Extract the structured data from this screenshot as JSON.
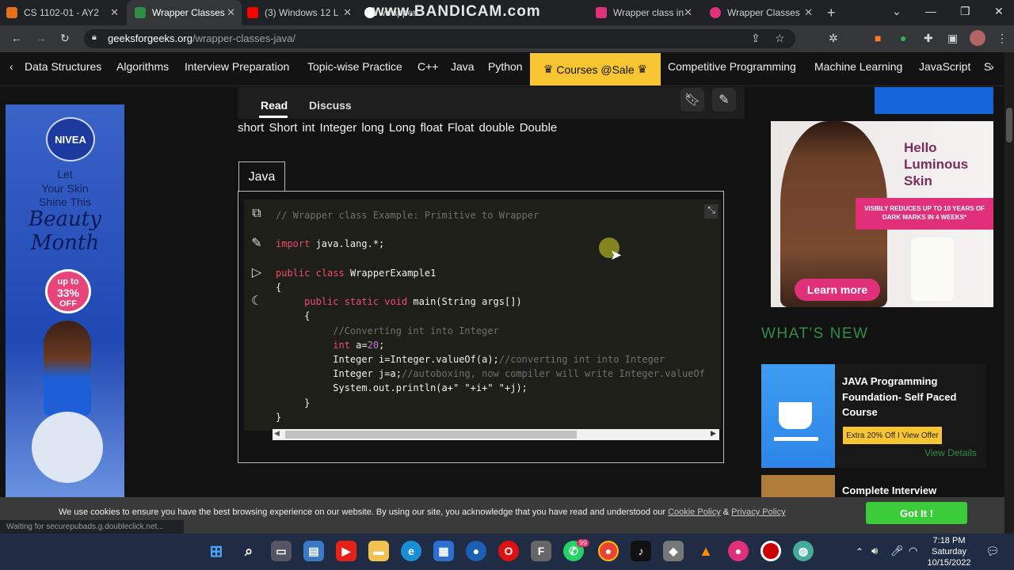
{
  "browser": {
    "tabs": [
      {
        "title": "CS 1102-01 - AY2",
        "favicon": "moodle-icon",
        "color": "#e7711b"
      },
      {
        "title": "Wrapper Classes",
        "favicon": "gfg-icon",
        "color": "#2f8d46"
      },
      {
        "title": "(3) Windows 12 L",
        "favicon": "youtube-icon",
        "color": "#ff0000"
      },
      {
        "title": "wrapper",
        "favicon": "google-icon",
        "color": "#ffffff"
      },
      {
        "title": "Wrapper class in",
        "favicon": "other-icon",
        "color": "#e0307a"
      },
      {
        "title": "Wrapper Classes",
        "favicon": "testbook-icon",
        "color": "#e0307a"
      }
    ],
    "new_tab": "+",
    "watermark": "www.BANDICAM.com",
    "url_domain": "geeksforgeeks.org",
    "url_path": "/wrapper-classes-java/"
  },
  "nav": {
    "items": [
      "Data Structures",
      "Algorithms",
      "Interview Preparation",
      "Topic-wise Practice",
      "C++",
      "Java",
      "Python"
    ],
    "courses": "Courses @Sale",
    "items_after": [
      "Competitive Programming",
      "Machine Learning",
      "JavaScript",
      "S"
    ]
  },
  "left_ad": {
    "brand": "NIVEA",
    "line1": "Let",
    "line2": "Your Skin",
    "line3": "Shine This",
    "headline": "Beauty Month",
    "badge_top": "up to",
    "badge_value": "33%",
    "badge_bottom": "OFF"
  },
  "article": {
    "tabs": {
      "read": "Read",
      "discuss": "Discuss"
    },
    "types_line": "short  Short  int Integer  long  Long  float  Float  double  Double",
    "language_tab": "Java",
    "code": {
      "line1": "// Wrapper class Example: Primitive to Wrapper",
      "import_kw": "import",
      "import_rest": " java.lang.*;",
      "public_kw": "public",
      "class_kw": "class",
      "class_name": " WrapperExample1",
      "open_brace": "{",
      "public_static_void": "public static void",
      "main_sig": " main(String args[])",
      "inner_open": "{",
      "comment2": "//Converting int into Integer",
      "int_kw": "int",
      "a_assign": " a=",
      "twenty": "20",
      "semi": ";",
      "integer_i": "Integer i=Integer.valueOf(a);",
      "comment3": "//converting int into Integer",
      "integer_j": "Integer j=a;",
      "comment4": "//autoboxing, now compiler will write Integer.valueOf",
      "println": "System.out.println(a+\" \"+i+\" \"+j);",
      "inner_close": "}",
      "close_brace": "}"
    }
  },
  "right": {
    "ad_headline": "Hello Luminous Skin",
    "ad_band": "VISIBLY REDUCES UP TO 10 YEARS OF DARK MARKS IN 4 WEEKS*",
    "ad_cta": "Learn more",
    "whats_new": "WHAT'S NEW",
    "card1_title": "JAVA Programming Foundation- Self Paced Course",
    "card1_offer": "Extra 20% Off I View Offer",
    "card1_link": "View Details",
    "card2_title": "Complete Interview"
  },
  "cookie": {
    "text": "We use cookies to ensure you have the best browsing experience on our website. By using our site, you acknowledge that you have read and understood our ",
    "policy": "Cookie Policy",
    "amp": " & ",
    "privacy": "Privacy Policy",
    "button": "Got It !"
  },
  "status": "Waiting for securepubads.g.doubleclick.net...",
  "taskbar": {
    "time": "7:18 PM",
    "day": "Saturday",
    "date": "10/15/2022",
    "whatsapp_badge": "99"
  }
}
